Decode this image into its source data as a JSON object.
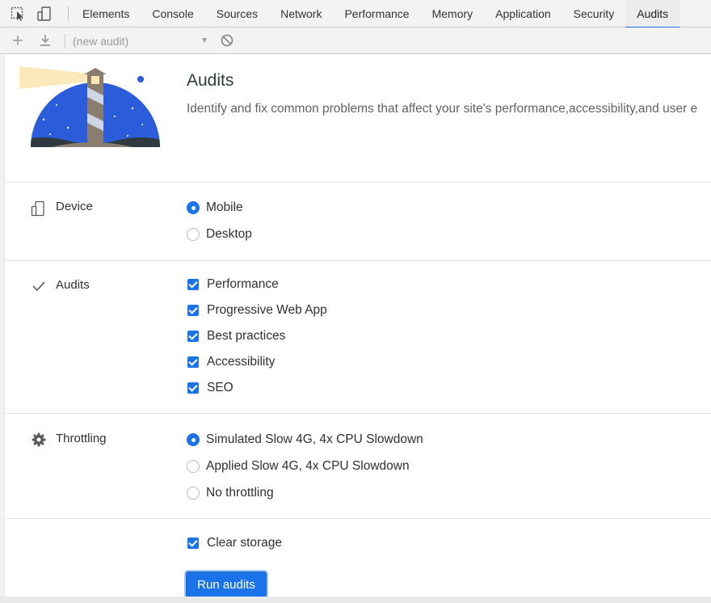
{
  "tabbar": {
    "tabs": [
      {
        "label": "Elements"
      },
      {
        "label": "Console"
      },
      {
        "label": "Sources"
      },
      {
        "label": "Network"
      },
      {
        "label": "Performance"
      },
      {
        "label": "Memory"
      },
      {
        "label": "Application"
      },
      {
        "label": "Security"
      },
      {
        "label": "Audits",
        "active": true
      }
    ],
    "icons": [
      "inspect-element-icon",
      "device-toolbar-icon"
    ]
  },
  "toolbar": {
    "icons": [
      "add-icon",
      "download-icon",
      "clear-icon"
    ],
    "audit_select_value": "(new audit)"
  },
  "hero": {
    "title": "Audits",
    "subtitle": "Identify and fix common problems that affect your site's performance,accessibility,and user e"
  },
  "device": {
    "label": "Device",
    "options": [
      {
        "label": "Mobile",
        "selected": true
      },
      {
        "label": "Desktop",
        "selected": false
      }
    ]
  },
  "audits": {
    "label": "Audits",
    "options": [
      {
        "label": "Performance",
        "checked": true
      },
      {
        "label": "Progressive Web App",
        "checked": true
      },
      {
        "label": "Best practices",
        "checked": true
      },
      {
        "label": "Accessibility",
        "checked": true
      },
      {
        "label": "SEO",
        "checked": true
      }
    ]
  },
  "throttling": {
    "label": "Throttling",
    "options": [
      {
        "label": "Simulated Slow 4G, 4x CPU Slowdown",
        "selected": true
      },
      {
        "label": "Applied Slow 4G, 4x CPU Slowdown",
        "selected": false
      },
      {
        "label": "No throttling",
        "selected": false
      }
    ]
  },
  "storage": {
    "label": "Clear storage",
    "checked": true
  },
  "run_button": {
    "label": "Run audits"
  },
  "colors": {
    "accent": "#1a73e8",
    "tabbar_bg": "#f3f3f3",
    "sky": "#2b5ddb",
    "beam": "#fbe7b3"
  }
}
